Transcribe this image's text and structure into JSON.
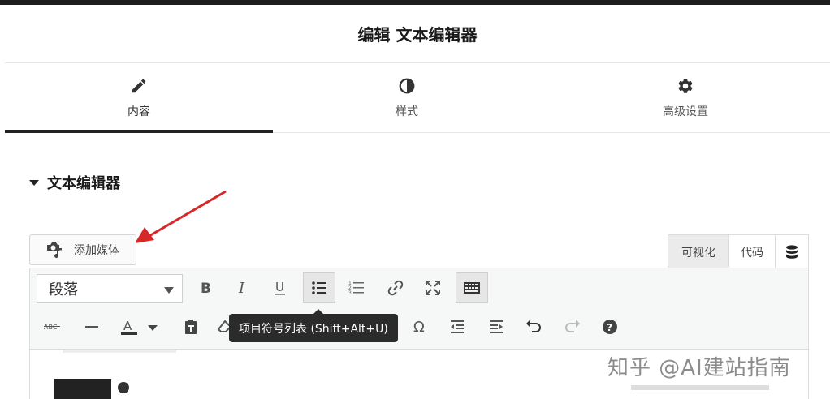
{
  "panel": {
    "title": "编辑 文本编辑器"
  },
  "tabs": [
    {
      "label": "内容",
      "icon": "pencil-icon",
      "active": true
    },
    {
      "label": "样式",
      "icon": "half-circle-icon",
      "active": false
    },
    {
      "label": "高级设置",
      "icon": "gear-icon",
      "active": false
    }
  ],
  "section": {
    "title": "文本编辑器"
  },
  "add_media": {
    "label": "添加媒体",
    "icon": "media-icon"
  },
  "mode_tabs": [
    {
      "label": "可视化",
      "active": true
    },
    {
      "label": "代码",
      "active": false
    },
    {
      "label": "",
      "icon": "database-icon"
    }
  ],
  "toolbar": {
    "format_select": "段落",
    "row1": [
      "bold",
      "italic",
      "underline",
      "bullet-list",
      "numbered-list",
      "link",
      "fullscreen",
      "toolbar-toggle"
    ],
    "row2": [
      "strikethrough",
      "horizontal-line",
      "text-color",
      "paste-text",
      "clear-formatting",
      "special-character",
      "outdent",
      "indent",
      "undo",
      "redo",
      "help"
    ]
  },
  "tooltip": {
    "text": "项目符号列表 (Shift+Alt+U)"
  },
  "watermark": {
    "text": "知乎 @AI建站指南"
  },
  "colors": {
    "accent": "#d62828",
    "active_tab_border": "#222222",
    "tooltip_bg": "#2b2b2b"
  }
}
